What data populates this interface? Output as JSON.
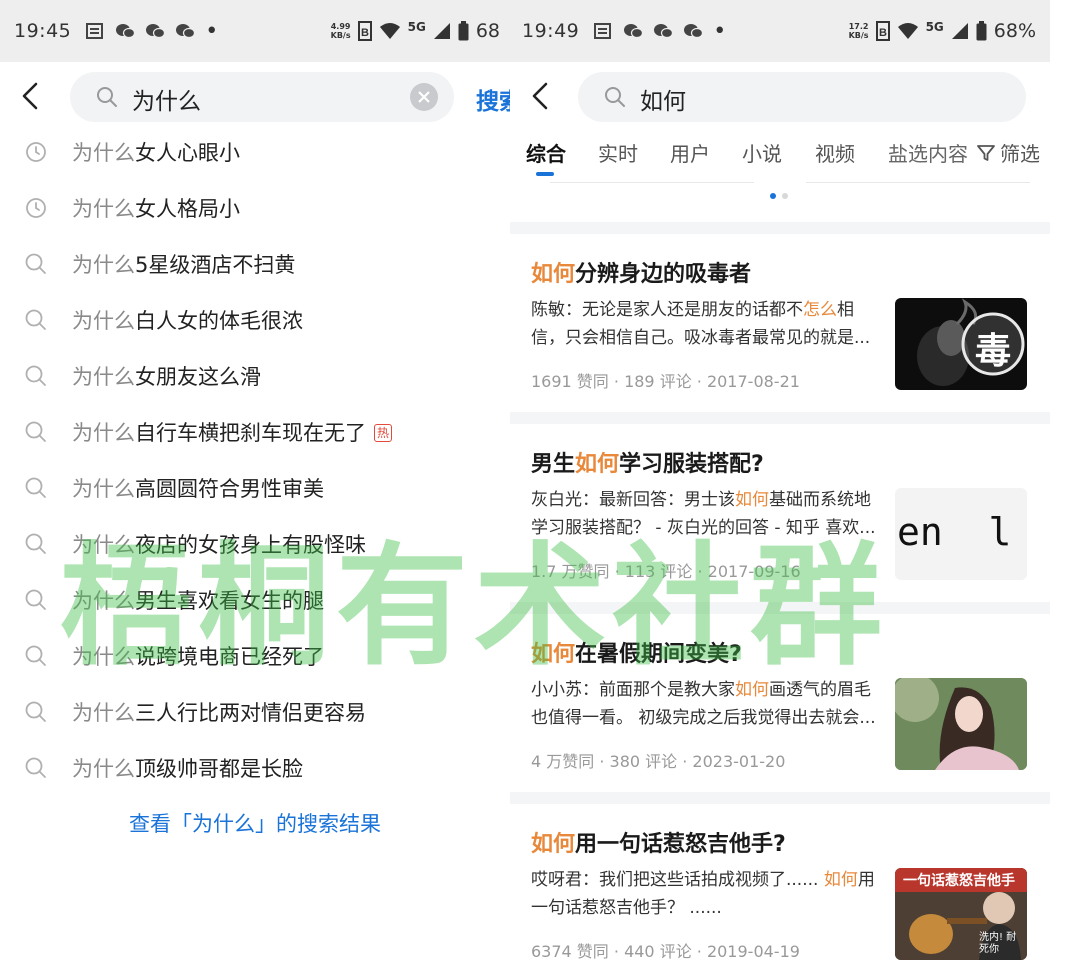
{
  "left": {
    "status": {
      "time": "19:45",
      "net_speed": "4.99",
      "net_unit": "KB/s",
      "network": "5G",
      "battery": "68"
    },
    "search": {
      "query": "为什么",
      "submit_label": "搜索"
    },
    "suggestions": [
      {
        "prefix": "为什么",
        "rest": "女人心眼小",
        "icon": "history-clock-icon"
      },
      {
        "prefix": "为什么",
        "rest": "女人格局小",
        "icon": "history-clock-icon"
      },
      {
        "prefix": "为什么",
        "rest": "5星级酒店不扫黄",
        "icon": "search-icon"
      },
      {
        "prefix": "为什么",
        "rest": "白人女的体毛很浓",
        "icon": "search-icon"
      },
      {
        "prefix": "为什么",
        "rest": "女朋友这么滑",
        "icon": "search-icon"
      },
      {
        "prefix": "为什么",
        "rest": "自行车横把刹车现在无了",
        "icon": "search-icon",
        "badge": "热"
      },
      {
        "prefix": "为什么",
        "rest": "高圆圆符合男性审美",
        "icon": "search-icon"
      },
      {
        "prefix": "为什么",
        "rest": "夜店的女孩身上有股怪味",
        "icon": "search-icon"
      },
      {
        "prefix": "为什么",
        "rest": "男生喜欢看女生的腿",
        "icon": "search-icon"
      },
      {
        "prefix": "为什么",
        "rest": "说跨境电商已经死了",
        "icon": "search-icon"
      },
      {
        "prefix": "为什么",
        "rest": "三人行比两对情侣更容易",
        "icon": "search-icon"
      },
      {
        "prefix": "为什么",
        "rest": "顶级帅哥都是长脸",
        "icon": "search-icon"
      }
    ],
    "view_all": "查看「为什么」的搜索结果"
  },
  "right": {
    "status": {
      "time": "19:49",
      "net_speed": "17.2",
      "net_unit": "KB/s",
      "network": "5G",
      "battery": "68%"
    },
    "search": {
      "query": "如何"
    },
    "tabs": [
      "综合",
      "实时",
      "用户",
      "小说",
      "视频",
      "盐选内容"
    ],
    "filter_label": "筛选",
    "results": [
      {
        "title_hl": "如何",
        "title_rest": "分辨身边的吸毒者",
        "excerpt_a": "陈敏：无论是家人还是朋友的话都不",
        "excerpt_hl": "怎么",
        "excerpt_b": "相信，只会相信自己。吸冰毒者最常见的就是...",
        "meta": "1691 赞同 · 189 评论 · 2017-08-21",
        "thumb_text": "毒"
      },
      {
        "title_pre": "男生",
        "title_hl": "如何",
        "title_rest": "学习服装搭配?",
        "excerpt_a": "灰白光：最新回答：男士该",
        "excerpt_hl": "如何",
        "excerpt_b": "基础而系统地学习服装搭配？ - 灰白光的回答 - 知乎 喜欢...",
        "meta": "1.7 万赞同 · 113 评论 · 2017-09-16",
        "thumb_text": "en  l i"
      },
      {
        "title_hl": "如何",
        "title_rest": "在暑假期间变美?",
        "excerpt_a": "小小苏：前面那个是教大家",
        "excerpt_hl": "如何",
        "excerpt_b": "画透气的眉毛也值得一看。 初级完成之后我觉得出去就会...",
        "meta": "4 万赞同 · 380 评论 · 2023-01-20"
      },
      {
        "title_hl": "如何",
        "title_rest": "用一句话惹怒吉他手?",
        "excerpt_a": "哎呀君：我们把这些话拍成视频了...... ",
        "excerpt_hl": "如何",
        "excerpt_b": "用一句话惹怒吉他手？ ......",
        "meta": "6374 赞同 · 440 评论 · 2019-04-19",
        "thumb_text_a": "一句话惹怒吉他手",
        "thumb_text_b": "洗内! 耐死你"
      }
    ]
  },
  "watermark": "梧桐有术社群",
  "colors": {
    "accent_blue": "#1a73d9",
    "highlight_orange": "#e8883a",
    "watermark_green": "#3cbe46"
  }
}
